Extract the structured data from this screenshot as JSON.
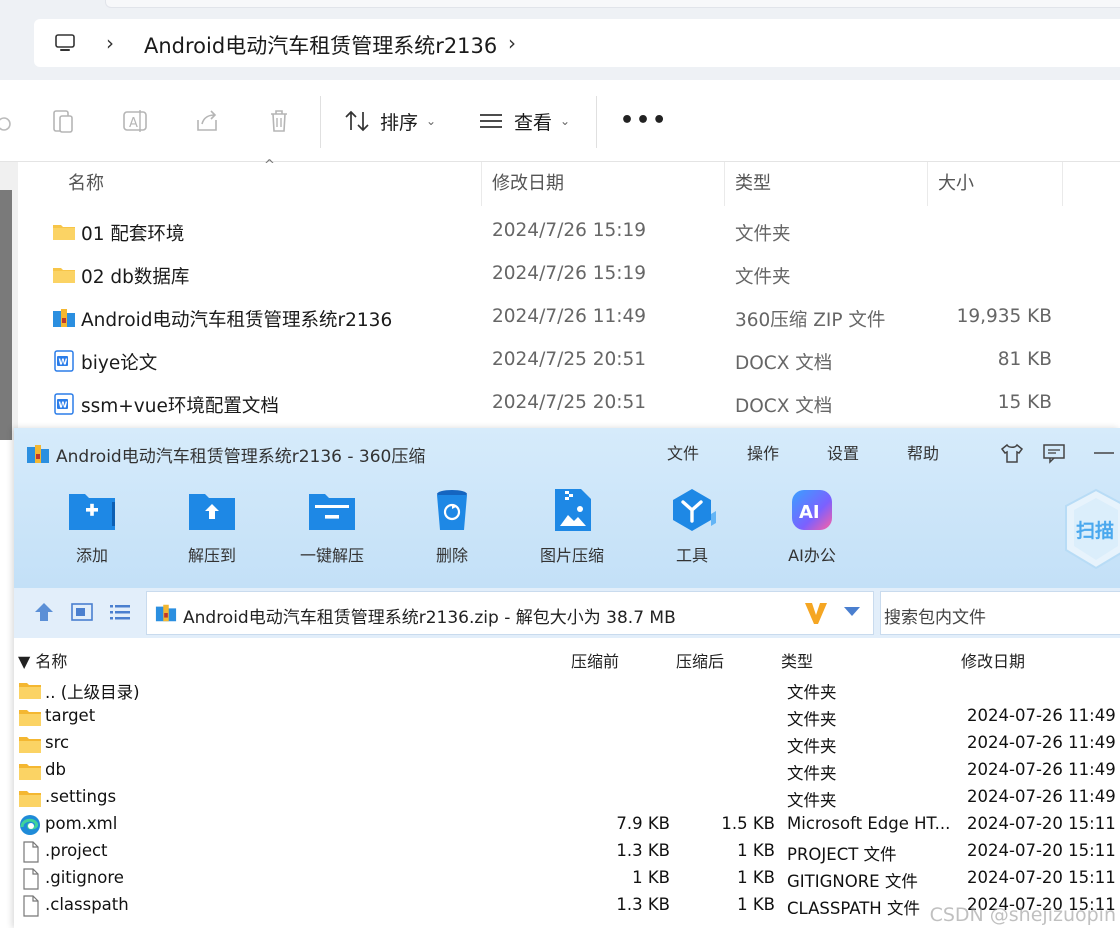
{
  "explorer": {
    "breadcrumb": "Android电动汽车租赁管理系统r2136",
    "toolbar": {
      "sort_label": "排序",
      "view_label": "查看",
      "more_label": "•••"
    },
    "columns": {
      "name": "名称",
      "modified": "修改日期",
      "type": "类型",
      "size": "大小"
    },
    "files": [
      {
        "icon": "folder-icon",
        "name": "01 配套环境",
        "date": "2024/7/26 15:19",
        "type": "文件夹",
        "size": ""
      },
      {
        "icon": "folder-icon",
        "name": "02 db数据库",
        "date": "2024/7/26 15:19",
        "type": "文件夹",
        "size": ""
      },
      {
        "icon": "zip-archive-icon",
        "name": "Android电动汽车租赁管理系统r2136",
        "date": "2024/7/26 11:49",
        "type": "360压缩 ZIP 文件",
        "size": "19,935 KB"
      },
      {
        "icon": "word-doc-icon",
        "name": "biye论文",
        "date": "2024/7/25 20:51",
        "type": "DOCX 文档",
        "size": "81 KB"
      },
      {
        "icon": "word-doc-icon",
        "name": "ssm+vue环境配置文档",
        "date": "2024/7/25 20:51",
        "type": "DOCX 文档",
        "size": "15 KB"
      }
    ]
  },
  "zip": {
    "title": "Android电动汽车租赁管理系统r2136 - 360压缩",
    "menu": [
      "文件",
      "操作",
      "设置",
      "帮助"
    ],
    "buttons": [
      {
        "label": "添加",
        "icon": "add-folder-icon"
      },
      {
        "label": "解压到",
        "icon": "extract-to-icon"
      },
      {
        "label": "一键解压",
        "icon": "one-click-extract-icon"
      },
      {
        "label": "删除",
        "icon": "delete-bin-icon"
      },
      {
        "label": "图片压缩",
        "icon": "image-compress-icon"
      },
      {
        "label": "工具",
        "icon": "tools-icon"
      },
      {
        "label": "AI办公",
        "icon": "ai-office-icon"
      }
    ],
    "scan_label": "扫描",
    "path": "Android电动汽车租赁管理系统r2136.zip - 解包大小为 38.7 MB",
    "search_placeholder": "搜索包内文件",
    "columns": {
      "name": "▼ 名称",
      "compressed_before": "压缩前",
      "compressed_after": "压缩后",
      "type": "类型",
      "modified": "修改日期"
    },
    "rows": [
      {
        "icon": "folder-icon",
        "name": ".. (上级目录)",
        "before": "",
        "after": "",
        "type": "文件夹",
        "date": ""
      },
      {
        "icon": "folder-icon",
        "name": "target",
        "before": "",
        "after": "",
        "type": "文件夹",
        "date": "2024-07-26 11:49"
      },
      {
        "icon": "folder-icon",
        "name": "src",
        "before": "",
        "after": "",
        "type": "文件夹",
        "date": "2024-07-26 11:49"
      },
      {
        "icon": "folder-icon",
        "name": "db",
        "before": "",
        "after": "",
        "type": "文件夹",
        "date": "2024-07-26 11:49"
      },
      {
        "icon": "folder-icon",
        "name": ".settings",
        "before": "",
        "after": "",
        "type": "文件夹",
        "date": "2024-07-26 11:49"
      },
      {
        "icon": "edge-icon",
        "name": "pom.xml",
        "before": "7.9 KB",
        "after": "1.5 KB",
        "type": "Microsoft Edge HT...",
        "date": "2024-07-20 15:11"
      },
      {
        "icon": "blank-file-icon",
        "name": ".project",
        "before": "1.3 KB",
        "after": "1 KB",
        "type": "PROJECT 文件",
        "date": "2024-07-20 15:11"
      },
      {
        "icon": "blank-file-icon",
        "name": ".gitignore",
        "before": "1 KB",
        "after": "1 KB",
        "type": "GITIGNORE 文件",
        "date": "2024-07-20 15:11"
      },
      {
        "icon": "blank-file-icon",
        "name": ".classpath",
        "before": "1.3 KB",
        "after": "1 KB",
        "type": "CLASSPATH 文件",
        "date": "2024-07-20 15:11"
      }
    ]
  },
  "watermark": "CSDN @shejizuopin",
  "colors": {
    "folder": "#f7c548",
    "zip_blue": "#1e88e5",
    "zip_header": "#cfe6f9",
    "accent": "#2b7de9"
  }
}
